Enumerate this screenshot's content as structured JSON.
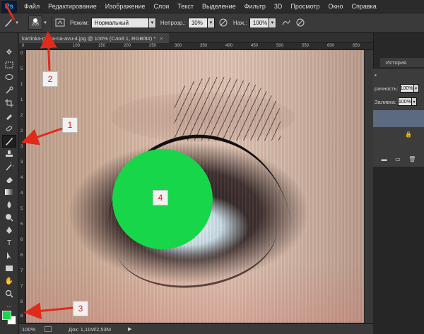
{
  "app": {
    "logo": "Ps"
  },
  "menu": [
    "Файл",
    "Редактирование",
    "Изображение",
    "Слои",
    "Текст",
    "Выделение",
    "Фильтр",
    "3D",
    "Просмотр",
    "Окно",
    "Справка"
  ],
  "options": {
    "brush_size": "205",
    "mode_label": "Режим:",
    "mode_value": "Нормальный",
    "opacity_label": "Непрозр.:",
    "opacity_value": "10%",
    "flow_label": "Наж.:",
    "flow_value": "100%"
  },
  "document": {
    "tab_title": "kartinka-glaza-na-avu-4.jpg @ 100% (Слой 1, RGB/8#) *",
    "zoom": "100%",
    "doc_info": "Док: 1,11M/2,53M"
  },
  "ruler": {
    "top": [
      "0",
      "50",
      "100",
      "150",
      "200",
      "250",
      "300",
      "350",
      "400",
      "450",
      "500",
      "550",
      "600",
      "650"
    ],
    "left": [
      "0",
      "5",
      "1",
      "1",
      "2",
      "2",
      "3",
      "3",
      "4",
      "4",
      "5",
      "5",
      "6",
      "6",
      "7",
      "7",
      "8",
      "8"
    ]
  },
  "panels": {
    "history_tab": "История",
    "opacity_label": "рачность:",
    "opacity_value": "100%",
    "fill_label": "Заливка:",
    "fill_value": "100%"
  },
  "annotations": {
    "badge_1": "1",
    "badge_2": "2",
    "badge_3": "3",
    "badge_4": "4",
    "color_red": "#e02a1c",
    "color_green": "#18d64a"
  }
}
